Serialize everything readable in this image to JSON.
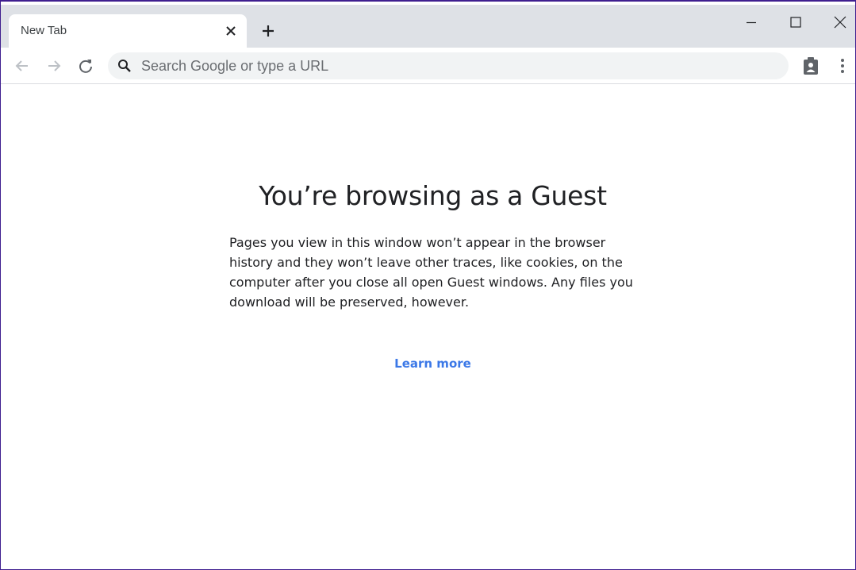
{
  "browser": {
    "tab": {
      "title": "New Tab",
      "close_icon": "close-icon"
    },
    "new_tab_icon": "plus-icon",
    "window_controls": [
      "minimize-icon",
      "maximize-icon",
      "close-icon"
    ],
    "toolbar": {
      "back_icon": "arrow-back-icon",
      "forward_icon": "arrow-forward-icon",
      "reload_icon": "reload-icon",
      "omnibox": {
        "placeholder": "Search Google or type a URL",
        "value": "",
        "icon": "search-icon"
      },
      "profile_icon": "guest-profile-icon",
      "menu_icon": "more-vert-icon"
    }
  },
  "page": {
    "title": "You’re browsing as a Guest",
    "body": "Pages you view in this window won’t appear in the browser history and they won’t leave other traces, like cookies, on the computer after you close all open Guest windows. Any files you download will be preserved, however.",
    "learn_more": "Learn more"
  },
  "colors": {
    "tabstrip": "#dee1e6",
    "omnibox": "#f1f3f4",
    "link": "#3b78e7",
    "frame_border": "#3f1f8f"
  }
}
